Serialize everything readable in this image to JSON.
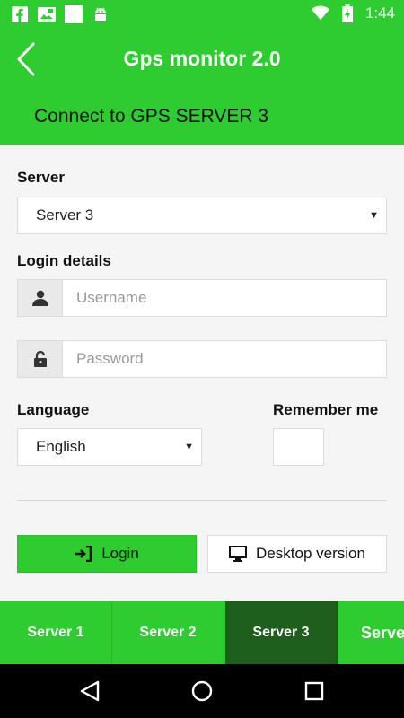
{
  "status_bar": {
    "time": "1:44",
    "icons": [
      "facebook-icon",
      "image-icon",
      "blank-notification-icon",
      "android-icon",
      "wifi-icon",
      "battery-charging-icon"
    ]
  },
  "app_bar": {
    "title": "Gps monitor 2.0",
    "subtitle": "Connect to GPS SERVER 3"
  },
  "form": {
    "server_label": "Server",
    "server_selected": "Server 3",
    "login_label": "Login details",
    "username_placeholder": "Username",
    "password_placeholder": "Password",
    "language_label": "Language",
    "language_selected": "English",
    "remember_label": "Remember me",
    "login_button": "Login",
    "desktop_button": "Desktop version"
  },
  "tabs": [
    {
      "label": "Server 1",
      "active": false
    },
    {
      "label": "Server 2",
      "active": false
    },
    {
      "label": "Server 3",
      "active": true
    },
    {
      "label": "Serve",
      "active": false
    }
  ],
  "colors": {
    "primary": "#2ecc30",
    "active_tab": "#1e5f1c",
    "nav_bar": "#000000"
  }
}
